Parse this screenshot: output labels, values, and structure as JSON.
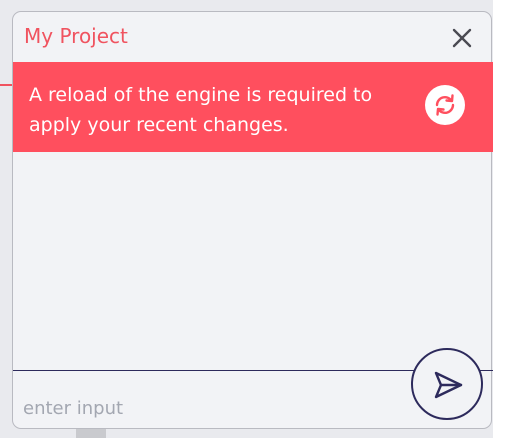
{
  "window": {
    "title": "My Project"
  },
  "banner": {
    "message": "A reload of the engine is required to apply your recent changes."
  },
  "input": {
    "placeholder": "enter input",
    "value": ""
  },
  "icons": {
    "close": "close-icon",
    "reload": "reload-icon",
    "send": "send-icon"
  },
  "colors": {
    "accent": "#ff4f5e",
    "title": "#f0535f",
    "dark": "#2d2a5c",
    "background": "#f2f3f6"
  }
}
